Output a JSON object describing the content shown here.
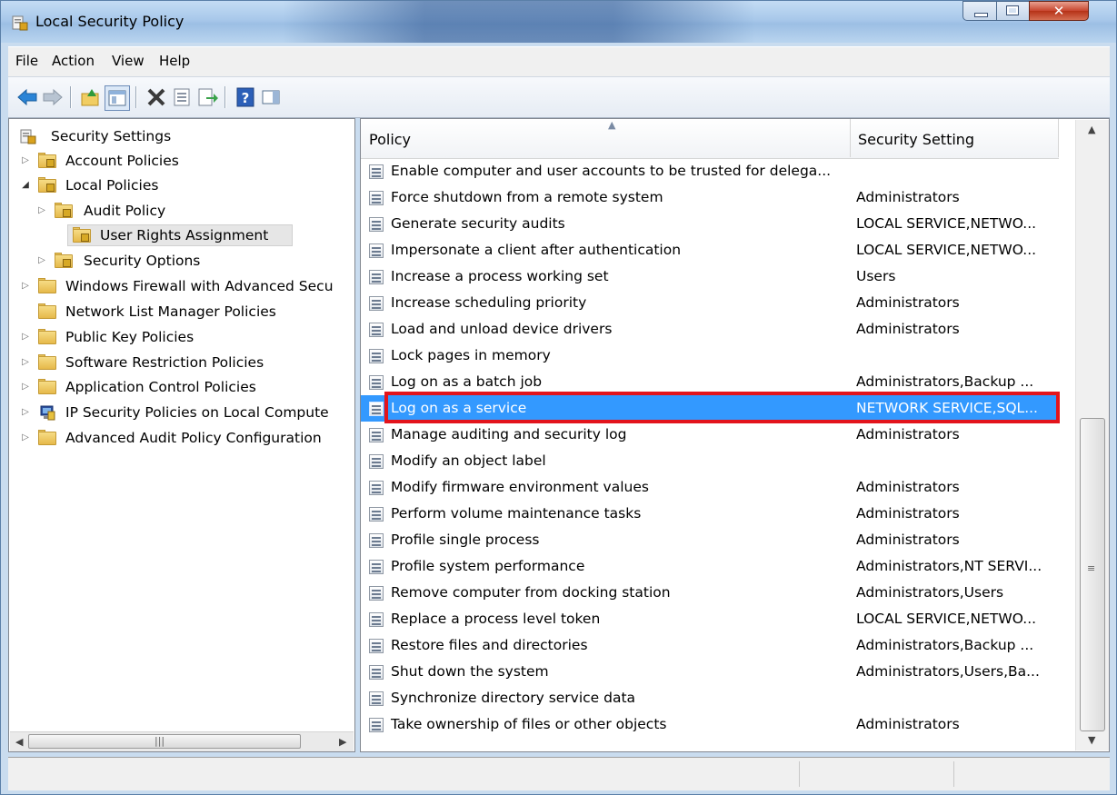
{
  "window": {
    "title": "Local Security Policy",
    "controls": {
      "minimize": "minimize",
      "maximize": "maximize",
      "close": "x"
    }
  },
  "menu": [
    {
      "label": "File"
    },
    {
      "label": "Action"
    },
    {
      "label": "View"
    },
    {
      "label": "Help"
    }
  ],
  "toolbar": [
    {
      "icon": "back-arrow-icon"
    },
    {
      "icon": "forward-arrow-icon"
    },
    {
      "icon": "up-folder-icon"
    },
    {
      "icon": "show-hide-console-tree-icon"
    },
    {
      "icon": "delete-icon"
    },
    {
      "icon": "properties-icon"
    },
    {
      "icon": "export-list-icon"
    },
    {
      "icon": "help-icon"
    },
    {
      "icon": "action-pane-icon"
    }
  ],
  "tree": {
    "root": "Security Settings",
    "items": [
      {
        "label": "Account Policies",
        "expander": "▷"
      },
      {
        "label": "Local Policies",
        "expander": "◢"
      },
      {
        "label": "Audit Policy",
        "expander": "▷"
      },
      {
        "label": "User Rights Assignment",
        "expander": "",
        "selected": true
      },
      {
        "label": "Security Options",
        "expander": "▷"
      },
      {
        "label": "Windows Firewall with Advanced Secu",
        "expander": "▷"
      },
      {
        "label": "Network List Manager Policies",
        "expander": ""
      },
      {
        "label": "Public Key Policies",
        "expander": "▷"
      },
      {
        "label": "Software Restriction Policies",
        "expander": "▷"
      },
      {
        "label": "Application Control Policies",
        "expander": "▷"
      },
      {
        "label": "IP Security Policies on Local Compute",
        "expander": "▷"
      },
      {
        "label": "Advanced Audit Policy Configuration",
        "expander": "▷"
      }
    ]
  },
  "list": {
    "columns": {
      "policy": "Policy",
      "setting": "Security Setting"
    },
    "rows": [
      {
        "policy": "Enable computer and user accounts to be trusted for delega...",
        "setting": ""
      },
      {
        "policy": "Force shutdown from a remote system",
        "setting": "Administrators"
      },
      {
        "policy": "Generate security audits",
        "setting": "LOCAL SERVICE,NETWO..."
      },
      {
        "policy": "Impersonate a client after authentication",
        "setting": "LOCAL SERVICE,NETWO..."
      },
      {
        "policy": "Increase a process working set",
        "setting": "Users"
      },
      {
        "policy": "Increase scheduling priority",
        "setting": "Administrators"
      },
      {
        "policy": "Load and unload device drivers",
        "setting": "Administrators"
      },
      {
        "policy": "Lock pages in memory",
        "setting": ""
      },
      {
        "policy": "Log on as a batch job",
        "setting": "Administrators,Backup ..."
      },
      {
        "policy": "Log on as a service",
        "setting": "NETWORK SERVICE,SQL...",
        "selected": true
      },
      {
        "policy": "Manage auditing and security log",
        "setting": "Administrators"
      },
      {
        "policy": "Modify an object label",
        "setting": ""
      },
      {
        "policy": "Modify firmware environment values",
        "setting": "Administrators"
      },
      {
        "policy": "Perform volume maintenance tasks",
        "setting": "Administrators"
      },
      {
        "policy": "Profile single process",
        "setting": "Administrators"
      },
      {
        "policy": "Profile system performance",
        "setting": "Administrators,NT SERVI..."
      },
      {
        "policy": "Remove computer from docking station",
        "setting": "Administrators,Users"
      },
      {
        "policy": "Replace a process level token",
        "setting": "LOCAL SERVICE,NETWO..."
      },
      {
        "policy": "Restore files and directories",
        "setting": "Administrators,Backup ..."
      },
      {
        "policy": "Shut down the system",
        "setting": "Administrators,Users,Ba..."
      },
      {
        "policy": "Synchronize directory service data",
        "setting": ""
      },
      {
        "policy": "Take ownership of files or other objects",
        "setting": "Administrators"
      }
    ]
  },
  "colors": {
    "selection": "#3399ff",
    "highlight_box": "#e3141c",
    "tree_selection": "#e6e6e6"
  }
}
